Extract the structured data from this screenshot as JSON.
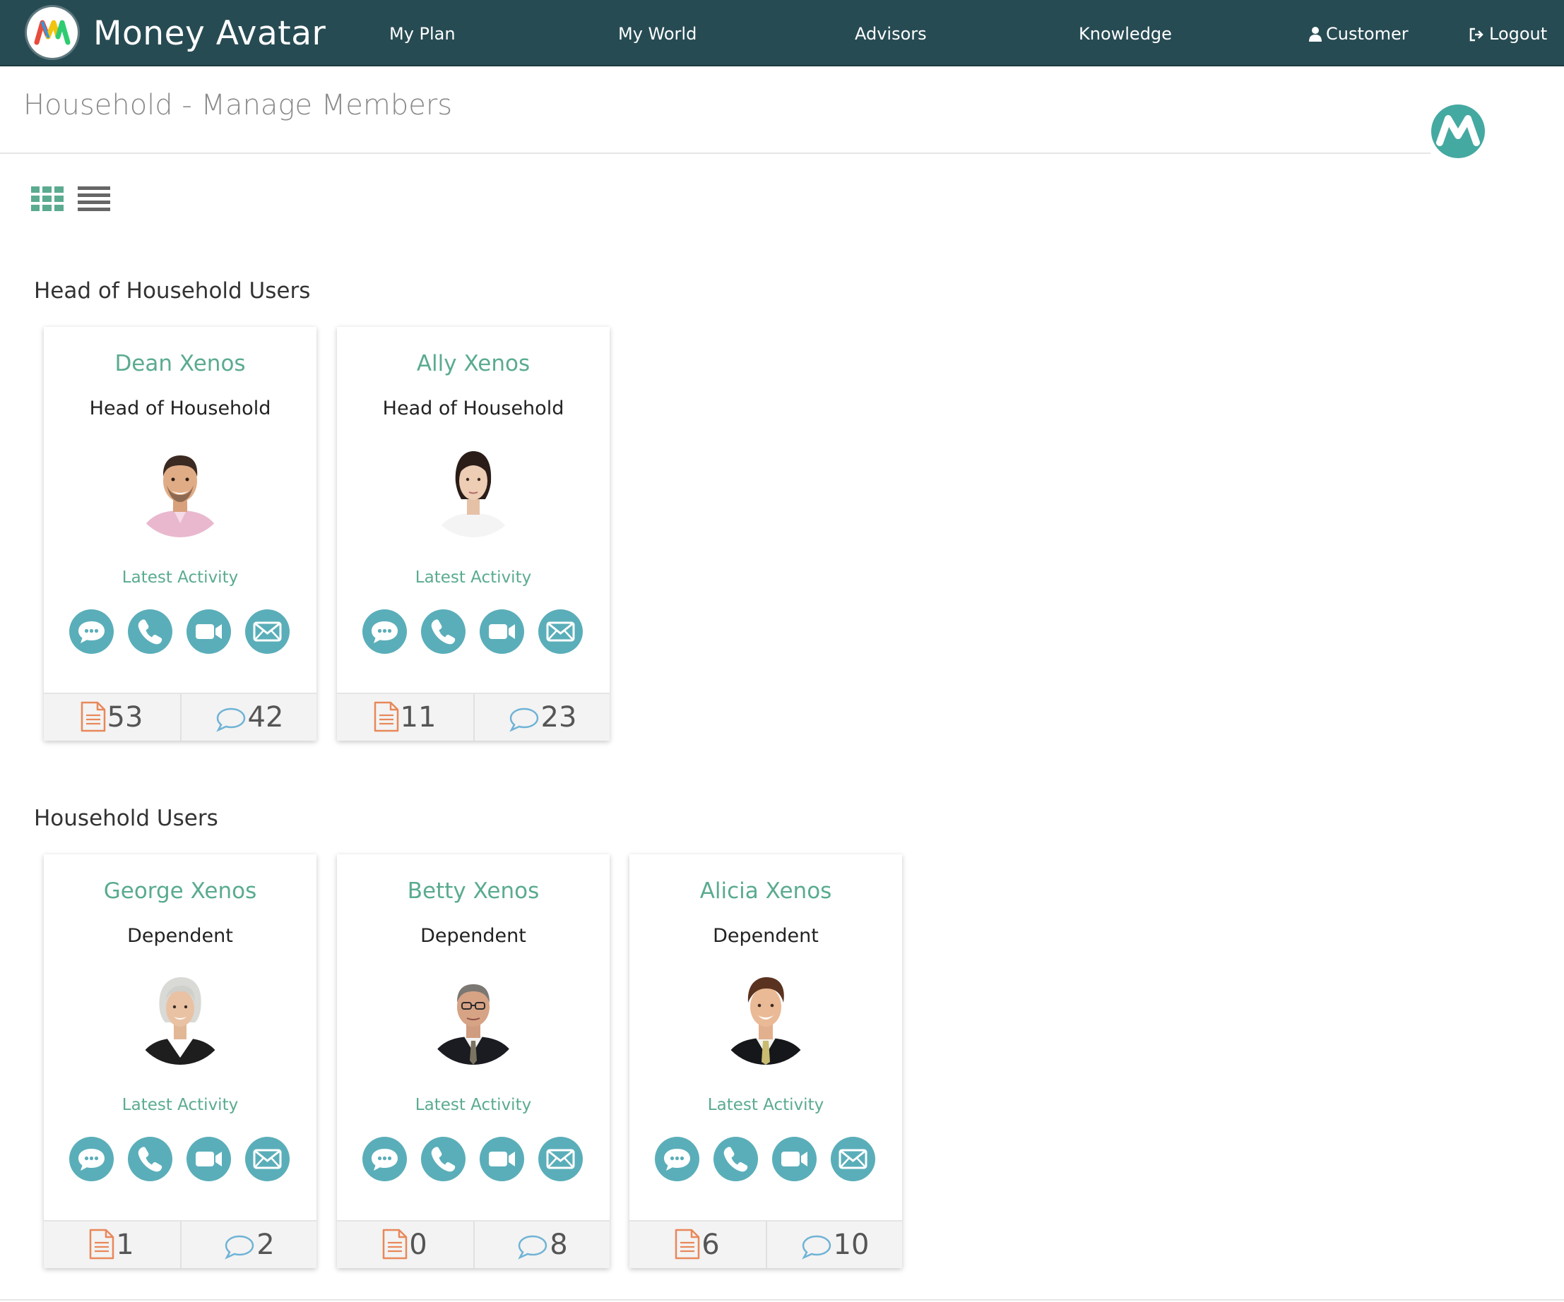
{
  "brand": {
    "name": "Money Avatar"
  },
  "nav": {
    "my_plan": "My Plan",
    "my_world": "My World",
    "advisors": "Advisors",
    "knowledge": "Knowledge",
    "customer": "Customer",
    "logout": "Logout"
  },
  "page": {
    "title": "Household - Manage Members"
  },
  "sections": {
    "head": "Head of Household Users",
    "household": "Household Users"
  },
  "members": [
    {
      "name": "Dean Xenos",
      "role": "Head of Household",
      "latest": "Latest Activity",
      "docs": "53",
      "messages": "42"
    },
    {
      "name": "Ally Xenos",
      "role": "Head of Household",
      "latest": "Latest Activity",
      "docs": "11",
      "messages": "23"
    },
    {
      "name": "George Xenos",
      "role": "Dependent",
      "latest": "Latest Activity",
      "docs": "1",
      "messages": "2"
    },
    {
      "name": "Betty Xenos",
      "role": "Dependent",
      "latest": "Latest Activity",
      "docs": "0",
      "messages": "8"
    },
    {
      "name": "Alicia Xenos",
      "role": "Dependent",
      "latest": "Latest Activity",
      "docs": "6",
      "messages": "10"
    }
  ],
  "colors": {
    "nav_bg": "#274b53",
    "accent_green": "#5aab8f",
    "action_teal": "#5aaeb9",
    "doc_orange": "#e8885a",
    "msg_blue": "#6fb3d6"
  },
  "icons": [
    "chat-icon",
    "phone-icon",
    "video-icon",
    "mail-icon",
    "document-icon",
    "speech-bubble-icon",
    "user-icon",
    "logout-icon",
    "grid-view-icon",
    "list-view-icon"
  ]
}
